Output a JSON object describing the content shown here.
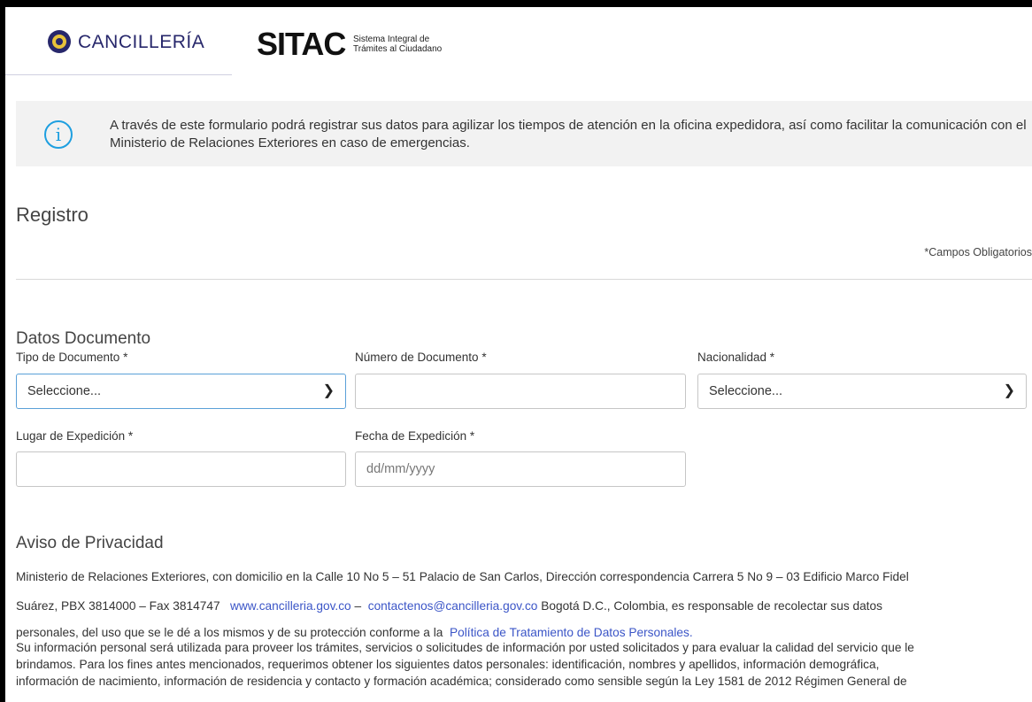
{
  "header": {
    "brand_name": "CANCILLERÍA",
    "sitac_logo": "SITAC",
    "sitac_sub_line1": "Sistema Integral de",
    "sitac_sub_line2": "Trámites al Ciudadano"
  },
  "info": {
    "icon": "info-icon",
    "text": "A través de este formulario podrá registrar sus datos para agilizar los tiempos de atención en la oficina expedidora, así como facilitar la comunicación con el Ministerio de Relaciones Exteriores en caso de emergencias."
  },
  "page": {
    "title": "Registro",
    "required_note": "*Campos Obligatorios"
  },
  "document": {
    "section_title": "Datos Documento",
    "tipo_label": "Tipo de Documento *",
    "tipo_value": "Seleccione...",
    "numero_label": "Número de Documento *",
    "numero_value": "",
    "nacionalidad_label": "Nacionalidad *",
    "nacionalidad_value": "Seleccione...",
    "lugar_label": "Lugar de Expedición *",
    "lugar_value": "",
    "fecha_label": "Fecha de Expedición *",
    "fecha_placeholder": "dd/mm/yyyy"
  },
  "privacy": {
    "title": "Aviso de Privacidad",
    "line1": "Ministerio de Relaciones Exteriores, con domicilio en la Calle 10 No 5 – 51 Palacio de San Carlos, Dirección correspondencia Carrera 5 No 9 – 03 Edificio Marco Fidel",
    "line2_a": "Suárez, PBX 3814000 – Fax 3814747",
    "link_web": "www.cancilleria.gov.co",
    "line2_dash": " – ",
    "link_email": "contactenos@cancilleria.gov.co",
    "line2_b": " Bogotá D.C., Colombia, es responsable de recolectar sus datos",
    "line3_a": "personales, del uso que se le dé a los mismos y de su protección conforme a la",
    "link_policy": "Política de Tratamiento de Datos Personales.",
    "line4": "Su información personal será utilizada para proveer los trámites, servicios o solicitudes de información por usted solicitados y para evaluar la calidad del servicio que le",
    "line5": "brindamos. Para los fines antes mencionados, requerimos obtener los siguientes datos personales: identificación, nombres y apellidos, información demográfica,",
    "line6": "información de nacimiento, información de residencia y contacto y formación académica; considerado como sensible según la Ley 1581 de 2012 Régimen General de"
  },
  "colors": {
    "brand": "#27276b",
    "info_icon": "#1e9fe0",
    "link": "#3b55c7",
    "focus_border": "#5aa0d8"
  }
}
